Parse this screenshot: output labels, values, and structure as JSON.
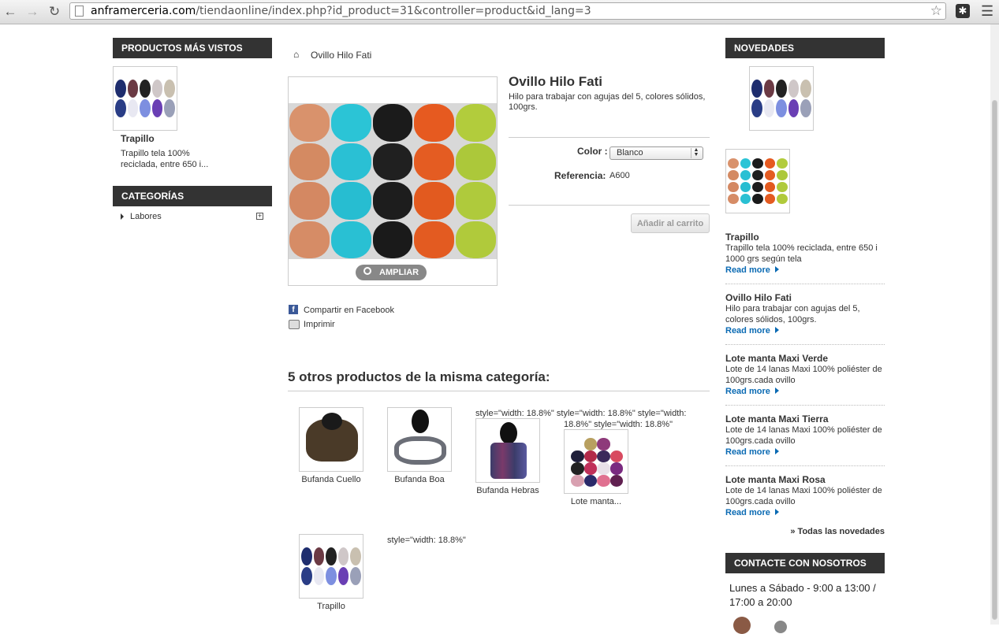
{
  "browser": {
    "url_domain": "anframerceria.com",
    "url_path": "/tiendaonline/index.php?id_product=31&controller=product&id_lang=3"
  },
  "left": {
    "most_viewed_title": "PRODUCTOS MÁS VISTOS",
    "most_viewed_item_title": "Trapillo",
    "most_viewed_item_desc": "Trapillo tela 100% reciclada, entre 650 i...",
    "categories_title": "CATEGORÍAS",
    "category_item": "Labores"
  },
  "breadcrumb": "Ovillo Hilo Fati",
  "product": {
    "title": "Ovillo Hilo Fati",
    "short_desc": "Hilo para trabajar con agujas del 5, colores sólidos, 100grs.",
    "color_label": "Color :",
    "color_value": "Blanco",
    "reference_label": "Referencia:",
    "reference_value": "A600",
    "add_to_cart": "Añadir al carrito",
    "zoom_label": "AMPLIAR",
    "share_facebook": "Compartir en Facebook",
    "print": "Imprimir"
  },
  "accessories": {
    "title": "5 otros productos de la misma categoría:",
    "items": [
      {
        "label": "Bufanda Cuello"
      },
      {
        "label": "Bufanda Boa"
      },
      {
        "label": "Bufanda Hebras",
        "above": "style=\"width: 18.8%\" style=\"width: 18.8%\" style=\"width:"
      },
      {
        "label": "Lote manta...",
        "above": "18.8%\" style=\"width: 18.8%\""
      },
      {
        "label": "Trapillo"
      }
    ],
    "stray_text": "style=\"width: 18.8%\""
  },
  "right": {
    "news_title": "NOVEDADES",
    "news": [
      {
        "title": "Trapillo",
        "desc": "Trapillo tela 100% reciclada, entre 650 i 1000 grs según tela",
        "more": "Read more"
      },
      {
        "title": "Ovillo Hilo Fati",
        "desc": "Hilo para trabajar con agujas del 5, colores sólidos, 100grs.",
        "more": "Read more"
      },
      {
        "title": "Lote manta Maxi Verde",
        "desc": "Lote de 14 lanas Maxi 100% poliéster de 100grs.cada ovillo",
        "more": "Read more"
      },
      {
        "title": "Lote manta Maxi Tierra",
        "desc": "Lote de 14 lanas Maxi 100% poliéster de 100grs.cada ovillo",
        "more": "Read more"
      },
      {
        "title": "Lote manta Maxi Rosa",
        "desc": "Lote de 14 lanas Maxi 100% poliéster de 100grs.cada ovillo",
        "more": "Read more"
      }
    ],
    "all_news": "» Todas las novedades",
    "contact_title": "CONTACTE CON NOSOTROS",
    "contact_hours": "Lunes a Sábado - 9:00 a 13:00 / 17:00 a 20:00"
  }
}
